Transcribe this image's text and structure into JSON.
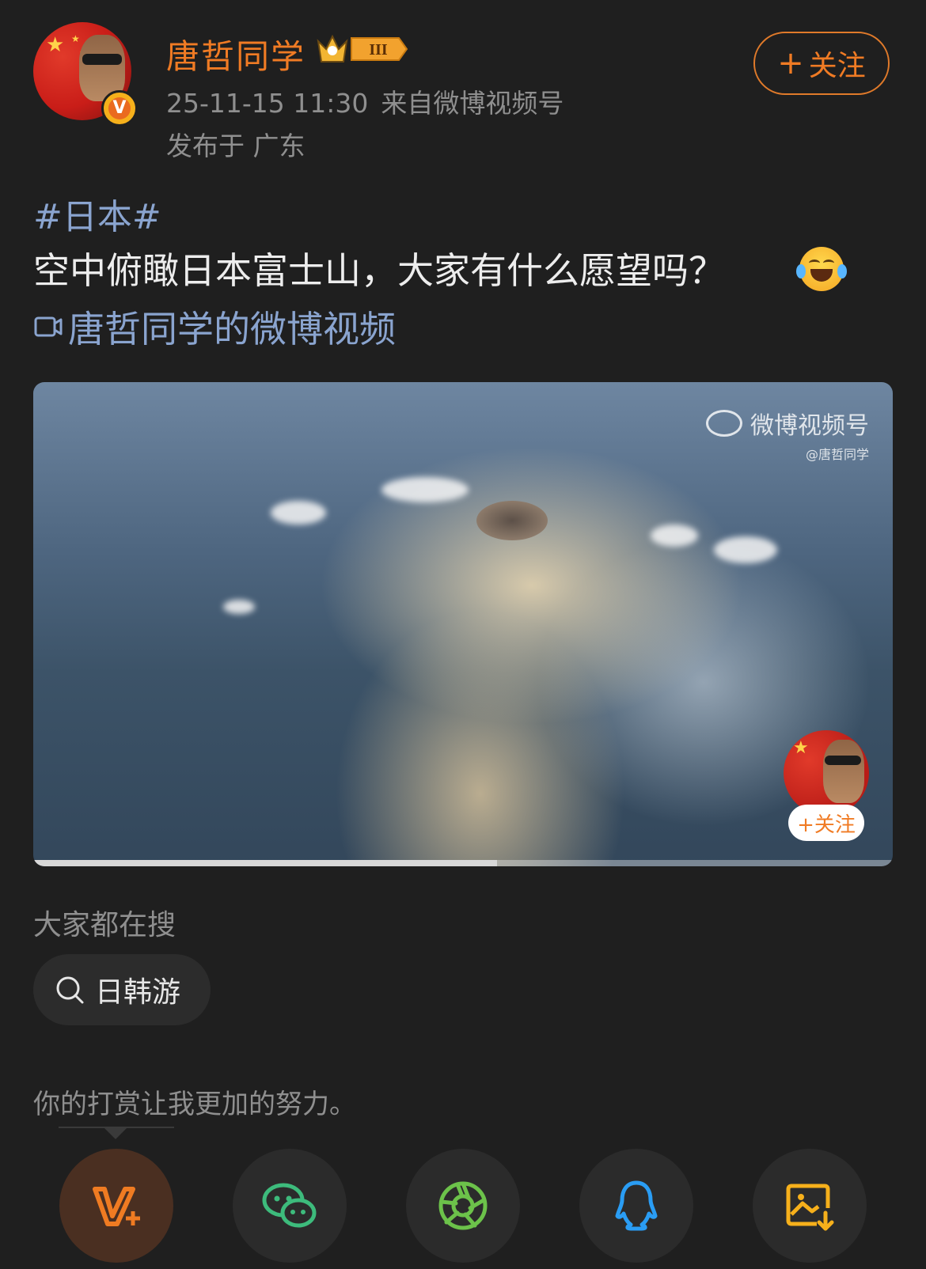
{
  "header": {
    "username": "唐哲同学",
    "level_badge": "III",
    "timestamp": "25-11-15 11:30",
    "source": "来自微博视频号",
    "location": "发布于 广东",
    "follow_label": "关注",
    "follow_plus": "+",
    "verified_mark": "V"
  },
  "post": {
    "hashtag": "#日本#",
    "text": "空中俯瞰日本富士山，大家有什么愿望吗？",
    "emoji": "laugh-cry-emoji",
    "video_link_text": "唐哲同学的微博视频"
  },
  "video": {
    "watermark_title": "微博视频号",
    "watermark_handle": "@唐哲同学",
    "mini_follow_label": "+关注",
    "progress": 0.54
  },
  "search": {
    "label": "大家都在搜",
    "chip_text": "日韩游"
  },
  "tip": {
    "text": "你的打赏让我更加的努力。"
  },
  "share_buttons": [
    {
      "name": "v-plus",
      "icon": "v-plus-icon",
      "color": "#ef7b22"
    },
    {
      "name": "wechat",
      "icon": "wechat-icon",
      "color": "#3dbb7c"
    },
    {
      "name": "moments",
      "icon": "moments-icon",
      "color": "#6cc24a"
    },
    {
      "name": "qq",
      "icon": "qq-icon",
      "color": "#2a9df4"
    },
    {
      "name": "save-image",
      "icon": "save-image-icon",
      "color": "#f6b01b"
    }
  ],
  "colors": {
    "background": "#1f1f1f",
    "accent": "#f07b24",
    "link": "#8aa4cf",
    "muted": "#8f8f8f"
  }
}
